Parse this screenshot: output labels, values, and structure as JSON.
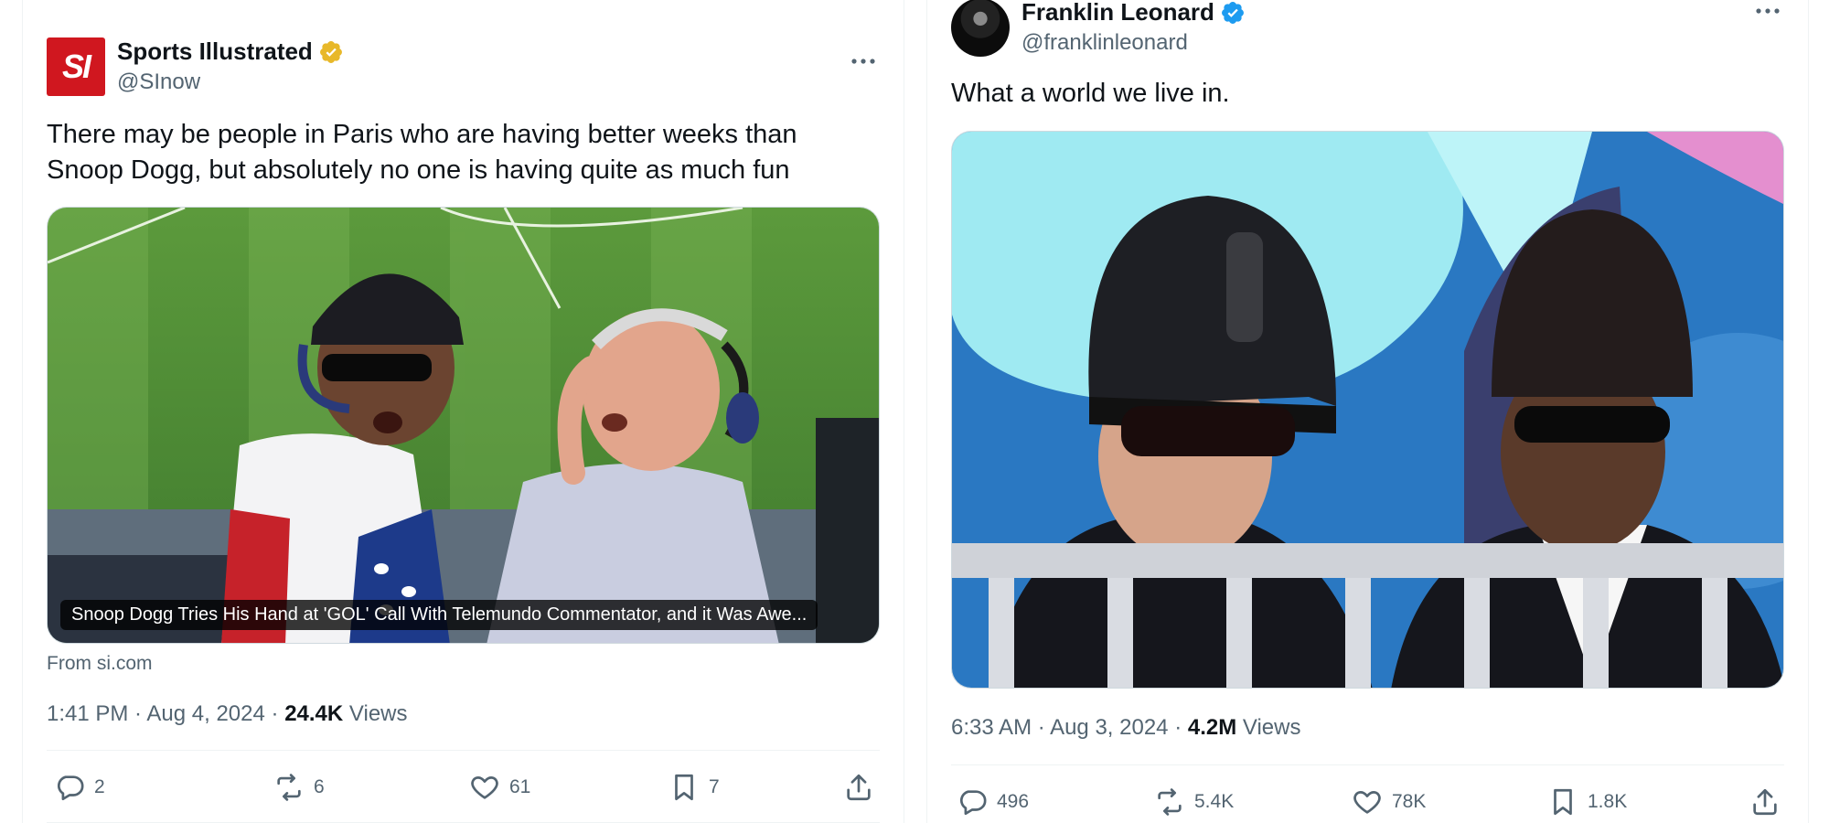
{
  "tweets": [
    {
      "author": {
        "name": "Sports Illustrated",
        "handle": "@SInow",
        "avatar_text": "SI",
        "verified": "gold"
      },
      "text": "There may be people in Paris who are having better weeks than Snoop Dogg, but absolutely no one is having quite as much fun",
      "media": {
        "caption": "Snoop Dogg Tries His Hand at 'GOL' Call With Telemundo Commentator, and it Was Awe...",
        "source": "From si.com"
      },
      "time": "1:41 PM",
      "date": "Aug 4, 2024",
      "views_count": "24.4K",
      "views_label": "Views",
      "stats": {
        "replies": "2",
        "reposts": "6",
        "likes": "61",
        "bookmarks": "7"
      }
    },
    {
      "author": {
        "name": "Franklin Leonard",
        "handle": "@franklinleonard",
        "verified": "blue"
      },
      "text": "What a world we live in.",
      "time": "6:33 AM",
      "date": "Aug 3, 2024",
      "views_count": "4.2M",
      "views_label": "Views",
      "stats": {
        "replies": "496",
        "reposts": "5.4K",
        "likes": "78K",
        "bookmarks": "1.8K"
      }
    }
  ],
  "colors": {
    "gold_badge": "#e8b829",
    "blue_badge": "#1d9bf0",
    "si_red": "#d0171f",
    "muted": "#536471"
  }
}
